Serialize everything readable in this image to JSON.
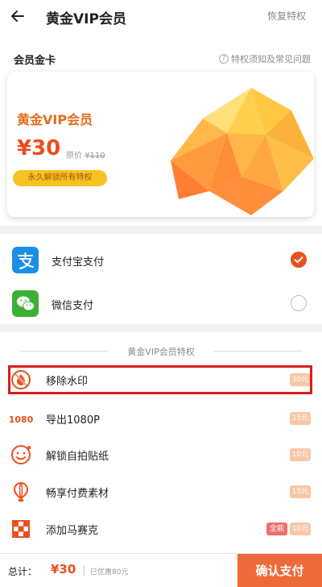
{
  "header": {
    "title": "黄金VIP会员",
    "restore": "恢复特权"
  },
  "card_section": {
    "title": "会员金卡",
    "help": "特权须知及常见问题",
    "card": {
      "name": "黄金VIP会员",
      "price": "¥30",
      "orig_label": "原价",
      "orig_price": "¥110",
      "unlock_label": "永久解锁所有特权"
    }
  },
  "payment": {
    "options": [
      {
        "label": "支付宝支付",
        "selected": true
      },
      {
        "label": "微信支付",
        "selected": false
      }
    ]
  },
  "privileges": {
    "header": "黄金VIP会员特权",
    "items": [
      {
        "label": "移除水印",
        "badge": "30元"
      },
      {
        "label": "导出1080P",
        "badge": "15元"
      },
      {
        "label": "解锁自拍贴纸",
        "badge": "10元"
      },
      {
        "label": "畅享付费素材",
        "badge": "15元"
      },
      {
        "label": "添加马赛克",
        "badge": "10元",
        "extra_badge": "全能"
      }
    ]
  },
  "icons": {
    "p1080": "1080"
  },
  "footer": {
    "total_label": "总计：",
    "total": "¥30",
    "saved": "已优惠80元",
    "confirm": "确认支付"
  },
  "colors": {
    "accent": "#e8501f",
    "gold": "#f7c224",
    "alipay": "#1a8fe6",
    "wechat": "#3cb035"
  }
}
